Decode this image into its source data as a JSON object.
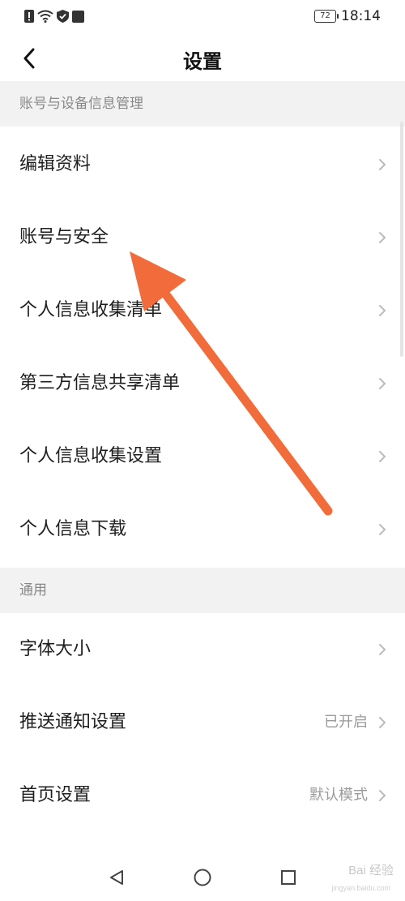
{
  "status_bar": {
    "battery": "72",
    "time": "18:14"
  },
  "header": {
    "title": "设置"
  },
  "sections": [
    {
      "title": "账号与设备信息管理",
      "items": [
        {
          "label": "编辑资料",
          "value": ""
        },
        {
          "label": "账号与安全",
          "value": ""
        },
        {
          "label": "个人信息收集清单",
          "value": ""
        },
        {
          "label": "第三方信息共享清单",
          "value": ""
        },
        {
          "label": "个人信息收集设置",
          "value": ""
        },
        {
          "label": "个人信息下载",
          "value": ""
        }
      ]
    },
    {
      "title": "通用",
      "items": [
        {
          "label": "字体大小",
          "value": ""
        },
        {
          "label": "推送通知设置",
          "value": "已开启"
        },
        {
          "label": "首页设置",
          "value": "默认模式"
        }
      ]
    }
  ],
  "watermark": {
    "text": "Bai 经验",
    "sub": "jingyan.baidu.com"
  },
  "colors": {
    "arrow": "#f26b3a",
    "section_bg": "#f2f2f2",
    "secondary_text": "#9a9a9a"
  }
}
